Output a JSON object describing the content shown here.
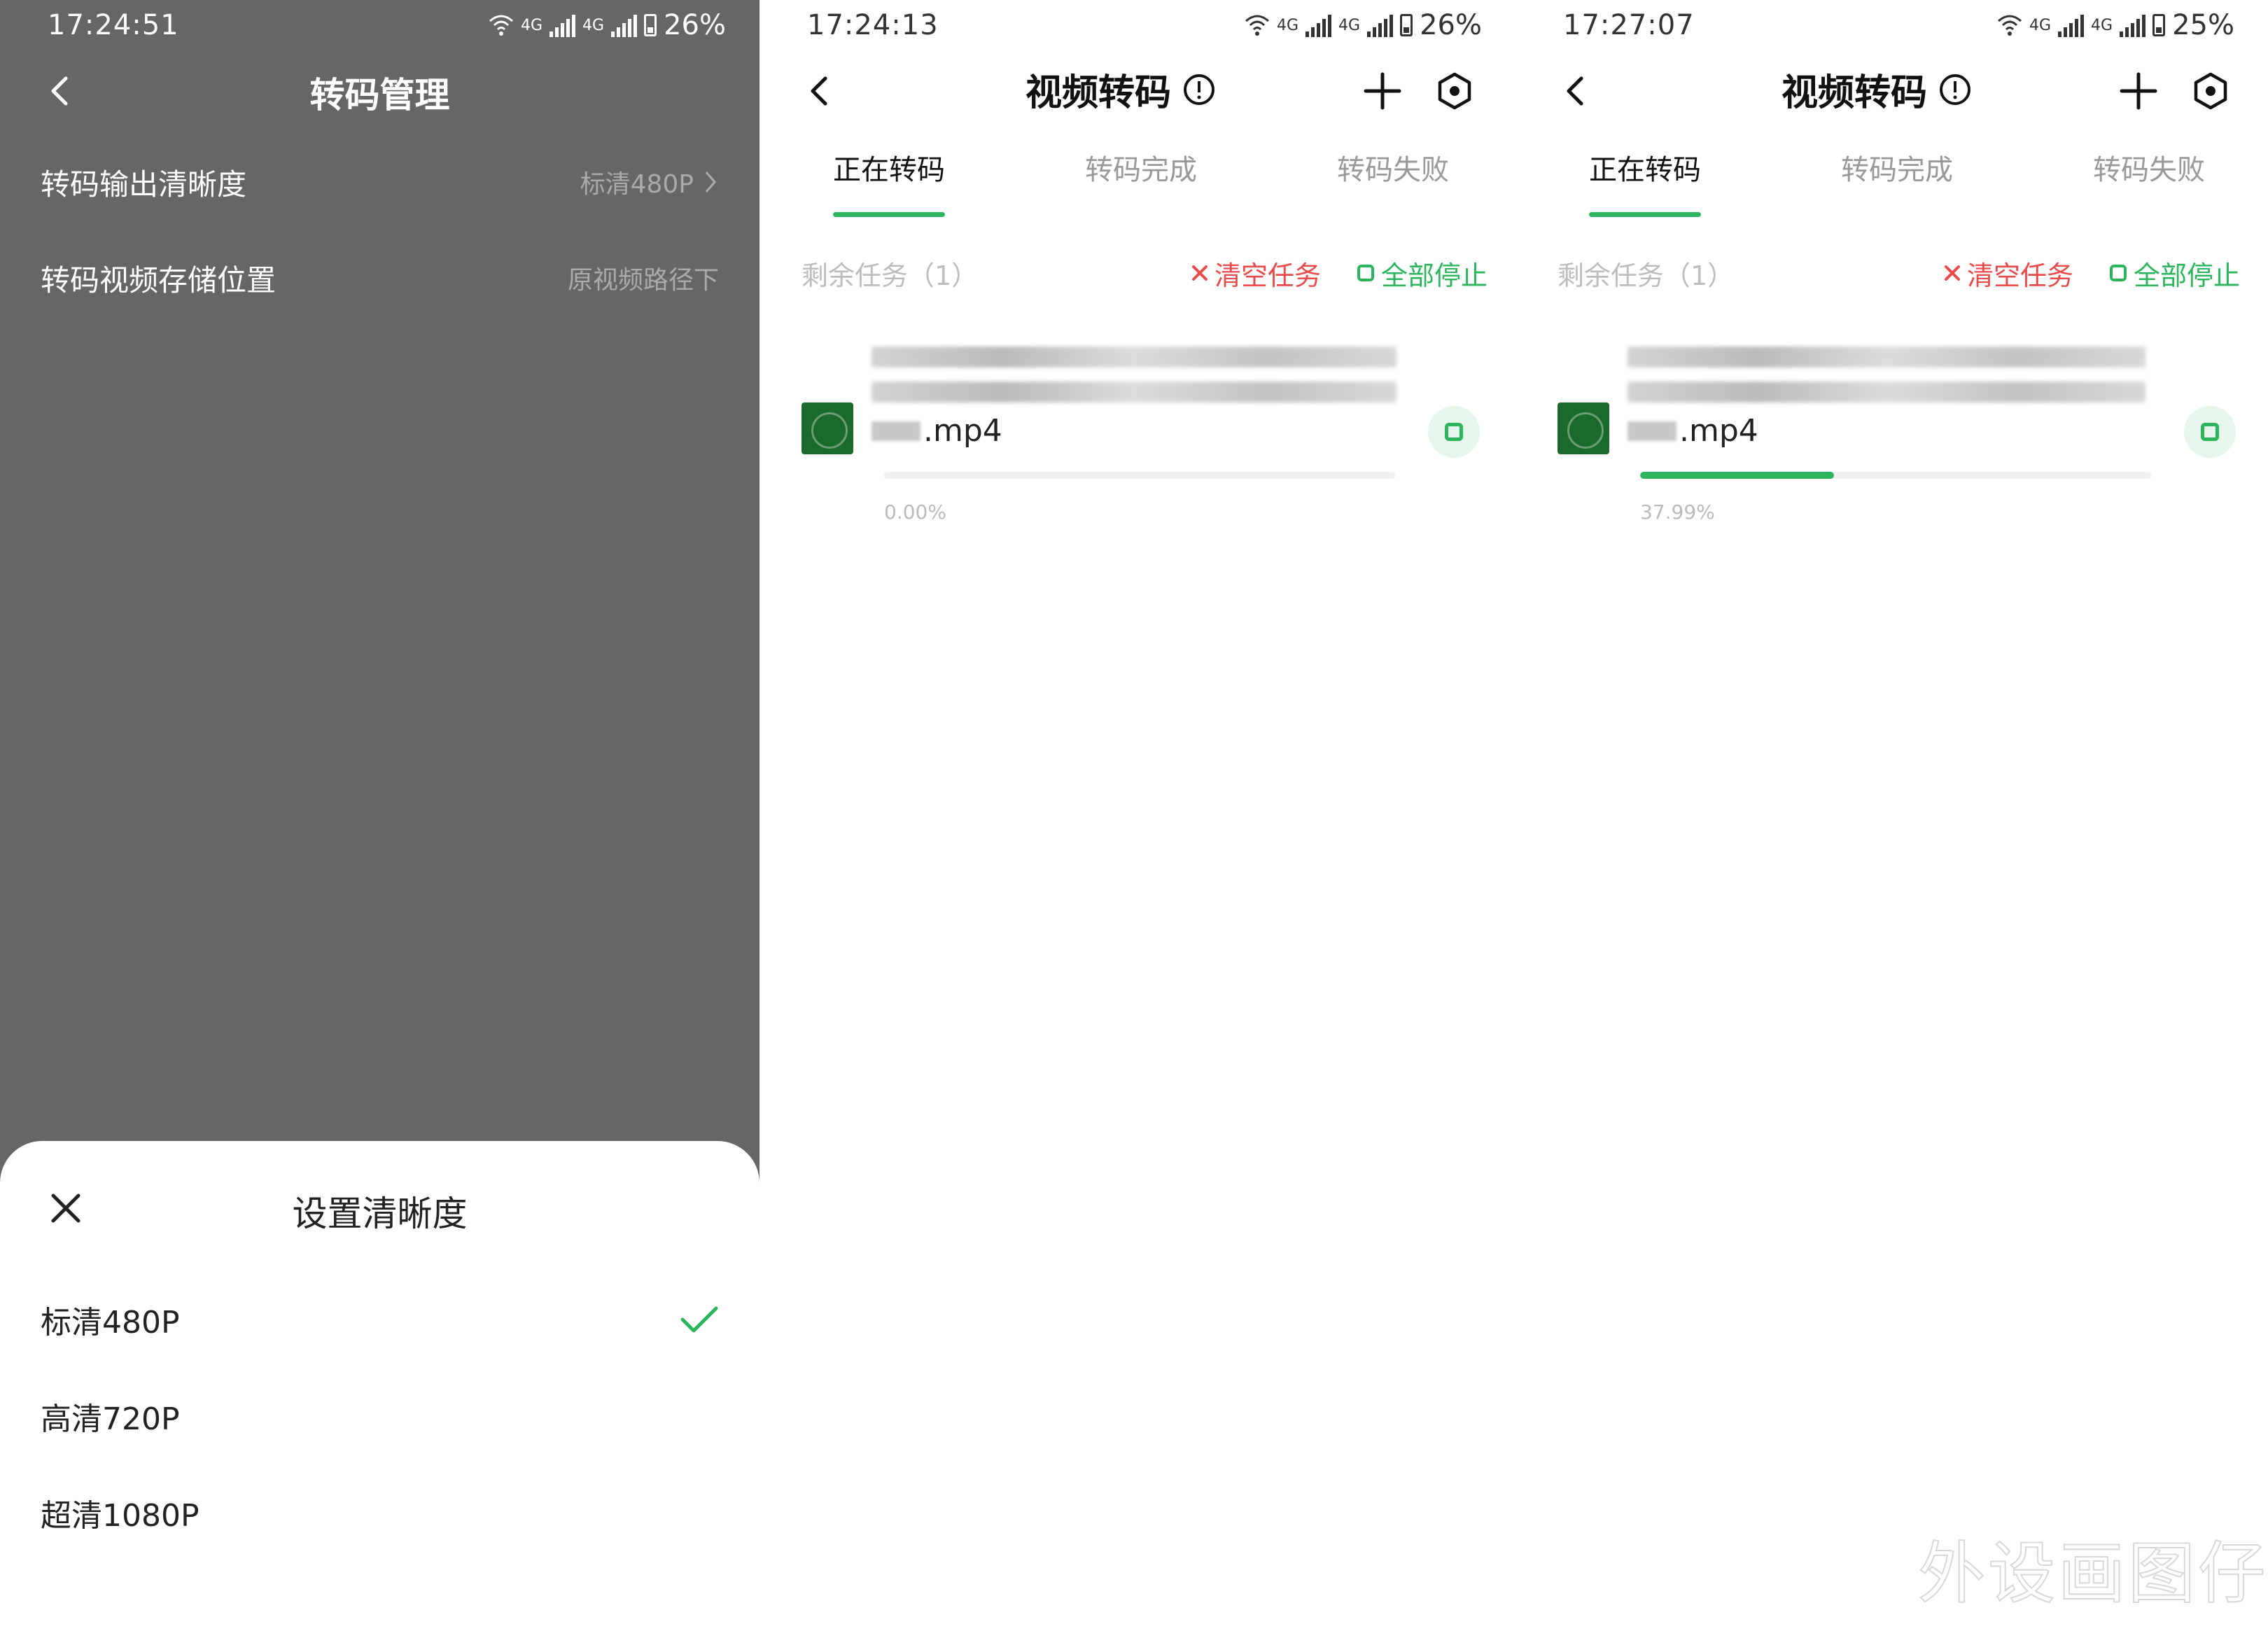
{
  "screen1": {
    "status": {
      "time": "17:24:51",
      "net1": "4G",
      "net2": "4G",
      "battery": "26%"
    },
    "title": "转码管理",
    "settings": [
      {
        "label": "转码输出清晰度",
        "value": "标清480P"
      },
      {
        "label": "转码视频存储位置",
        "value": "原视频路径下"
      }
    ],
    "sheet": {
      "title": "设置清晰度",
      "options": [
        {
          "label": "标清480P",
          "selected": true
        },
        {
          "label": "高清720P",
          "selected": false
        },
        {
          "label": "超清1080P",
          "selected": false
        }
      ]
    }
  },
  "screen2": {
    "status": {
      "time": "17:24:13",
      "net1": "4G",
      "net2": "4G",
      "battery": "26%"
    },
    "title": "视频转码",
    "tabs": [
      "正在转码",
      "转码完成",
      "转码失败"
    ],
    "active_tab": "正在转码",
    "remaining": "剩余任务（1）",
    "clear_label": "清空任务",
    "stop_all_label": "全部停止",
    "task": {
      "file_suffix": ".mp4",
      "progress": 0.0,
      "progress_text": "0.00%"
    }
  },
  "screen3": {
    "status": {
      "time": "17:27:07",
      "net1": "4G",
      "net2": "4G",
      "battery": "25%"
    },
    "title": "视频转码",
    "tabs": [
      "正在转码",
      "转码完成",
      "转码失败"
    ],
    "active_tab": "正在转码",
    "remaining": "剩余任务（1）",
    "clear_label": "清空任务",
    "stop_all_label": "全部停止",
    "task": {
      "file_suffix": ".mp4",
      "progress": 37.99,
      "progress_text": "37.99%"
    }
  },
  "watermark": "外设画图仔",
  "colors": {
    "accent": "#2db55d",
    "danger": "#e94b4b",
    "overlay": "#666666"
  }
}
